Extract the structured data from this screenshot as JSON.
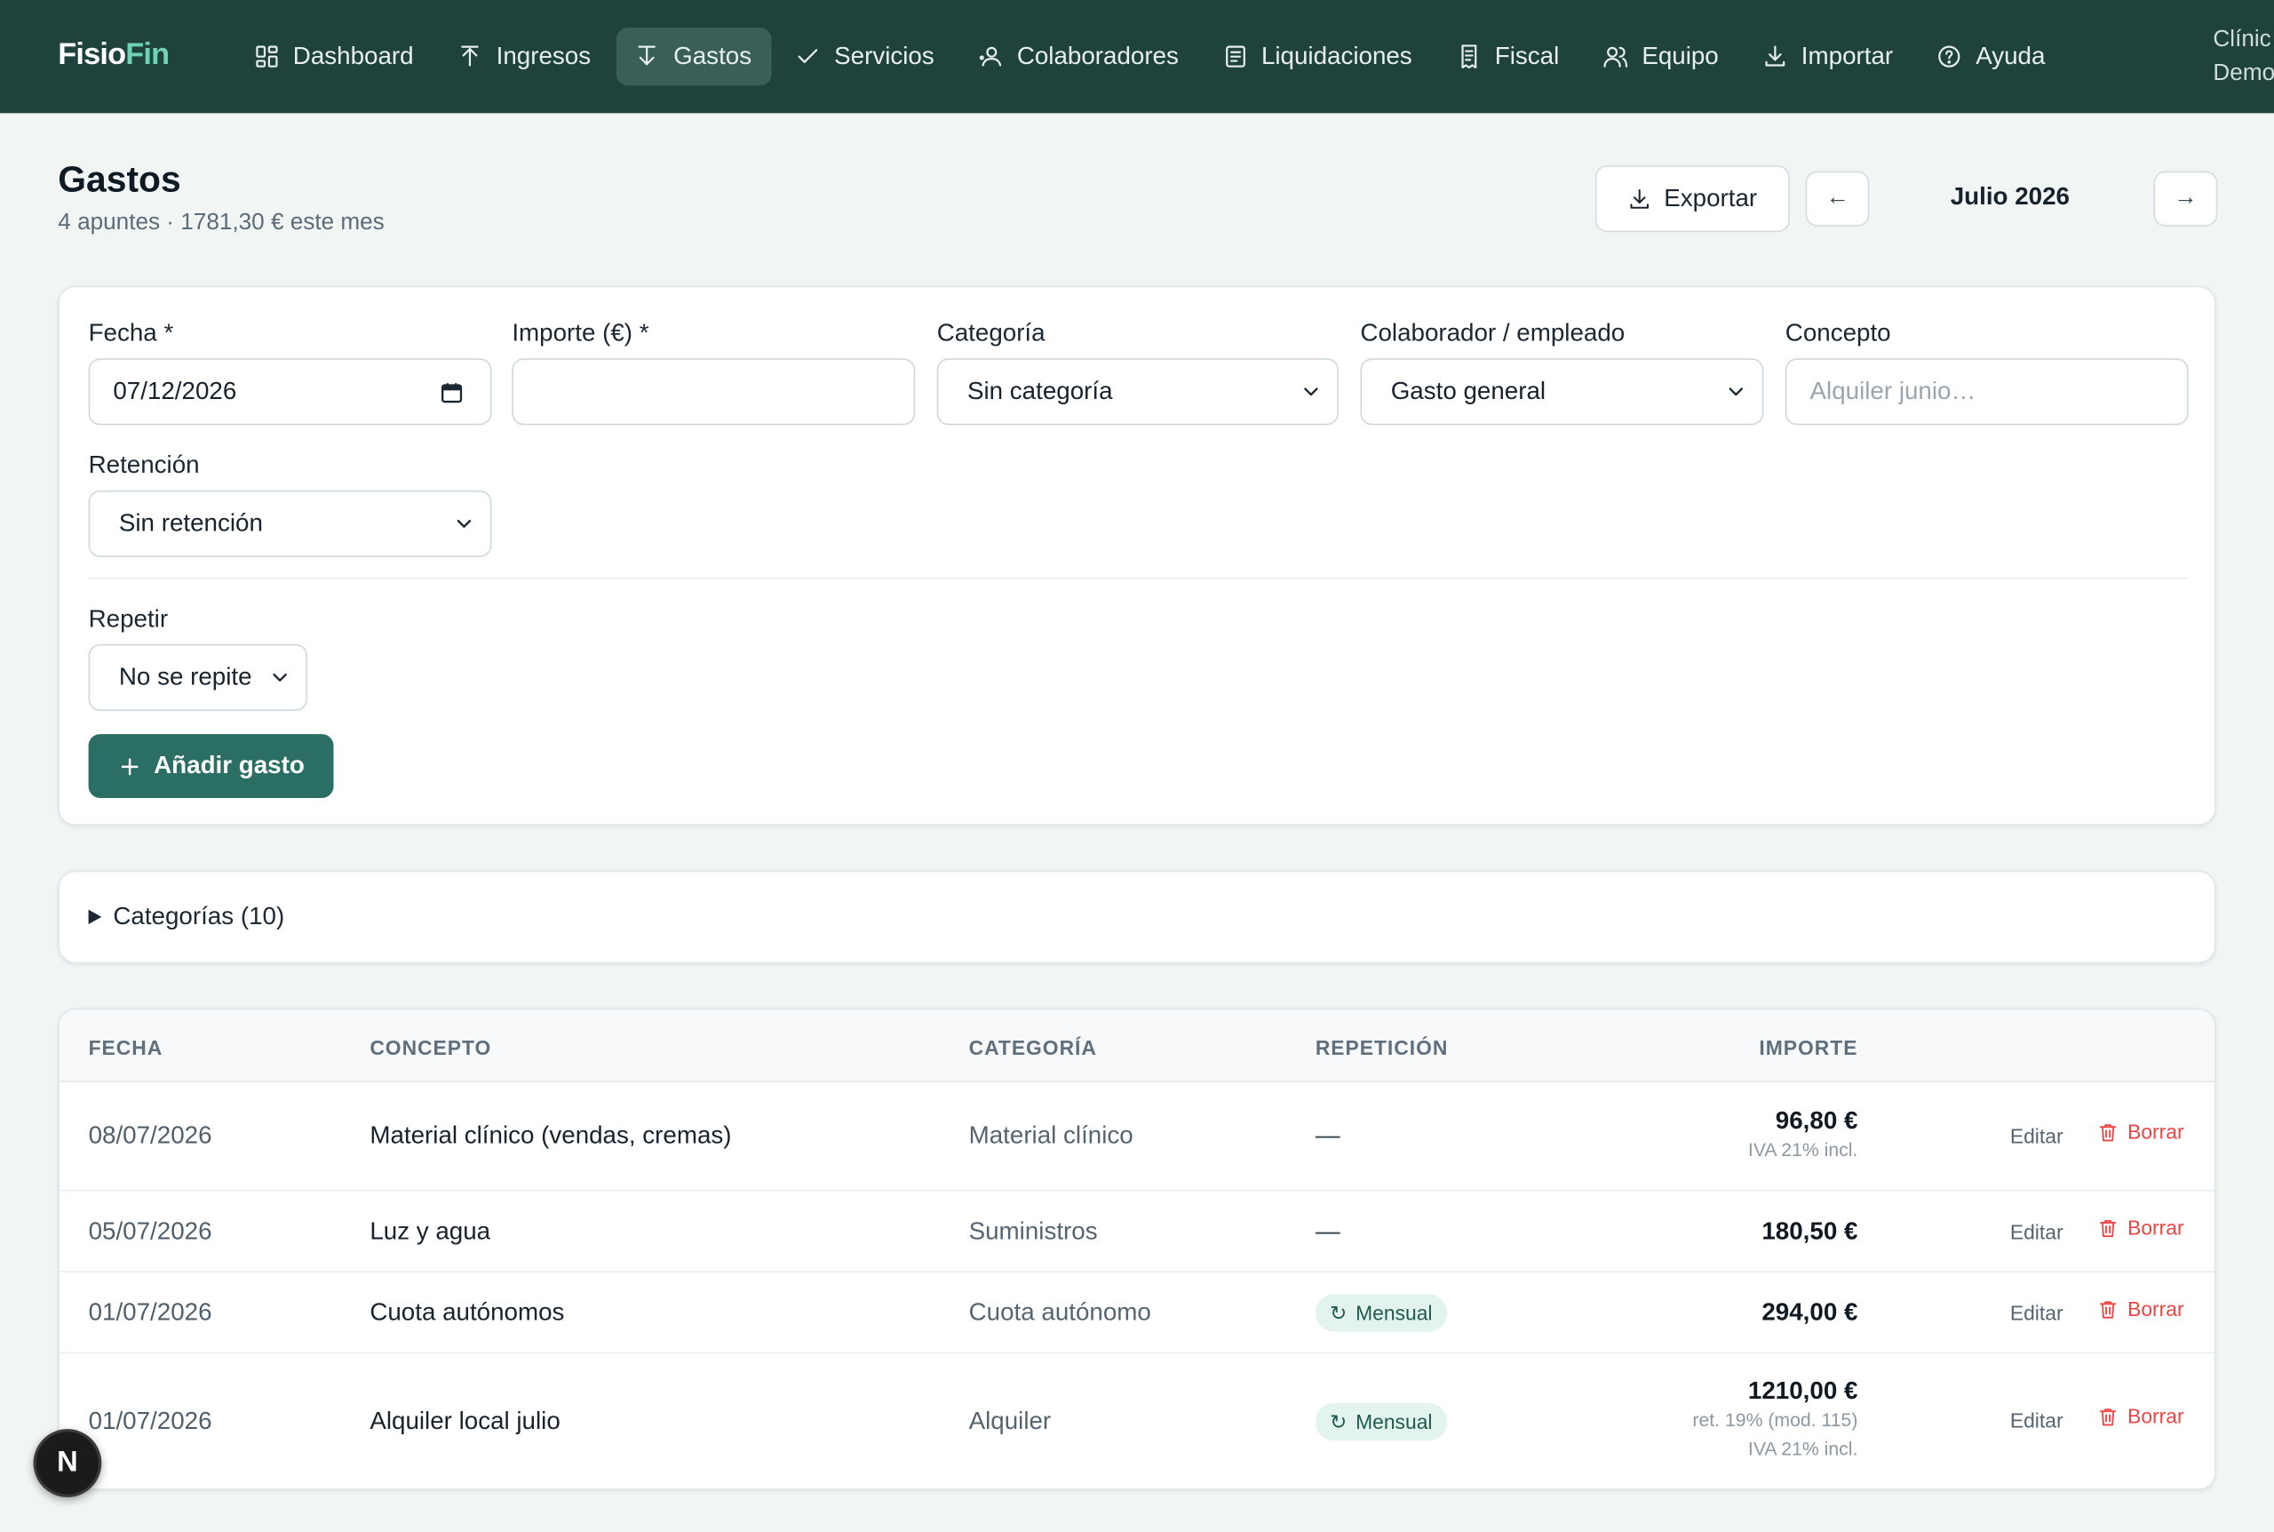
{
  "brand": {
    "part1": "Fisio",
    "part2": "Fin"
  },
  "nav": [
    {
      "label": "Dashboard",
      "icon": "dashboard-icon"
    },
    {
      "label": "Ingresos",
      "icon": "upload-icon"
    },
    {
      "label": "Gastos",
      "icon": "download-bar-icon",
      "active": true
    },
    {
      "label": "Servicios",
      "icon": "check-icon"
    },
    {
      "label": "Colaboradores",
      "icon": "user-icon"
    },
    {
      "label": "Liquidaciones",
      "icon": "document-icon"
    },
    {
      "label": "Fiscal",
      "icon": "receipt-icon"
    },
    {
      "label": "Equipo",
      "icon": "users-icon"
    },
    {
      "label": "Importar",
      "icon": "import-icon"
    },
    {
      "label": "Ayuda",
      "icon": "help-icon"
    }
  ],
  "clinic": {
    "line1": "Clínic",
    "line2": "Demo"
  },
  "header": {
    "title": "Gastos",
    "subtitle": "4 apuntes · 1781,30 € este mes",
    "export_label": "Exportar",
    "prev_label": "←",
    "next_label": "→",
    "month": "Julio 2026"
  },
  "form": {
    "fecha_label": "Fecha *",
    "fecha_value": "07/12/2026",
    "importe_label": "Importe (€) *",
    "importe_value": "",
    "categoria_label": "Categoría",
    "categoria_value": "Sin categoría",
    "colaborador_label": "Colaborador / empleado",
    "colaborador_value": "Gasto general",
    "concepto_label": "Concepto",
    "concepto_placeholder": "Alquiler junio…",
    "retencion_label": "Retención",
    "retencion_value": "Sin retención",
    "repetir_label": "Repetir",
    "repetir_value": "No se repite",
    "add_label": "Añadir gasto"
  },
  "categories_toggle": "Categorías (10)",
  "table": {
    "headers": {
      "fecha": "FECHA",
      "concepto": "CONCEPTO",
      "categoria": "CATEGORÍA",
      "repeticion": "REPETICIÓN",
      "importe": "IMPORTE"
    },
    "edit_label": "Editar",
    "delete_label": "Borrar",
    "rows": [
      {
        "fecha": "08/07/2026",
        "concepto": "Material clínico (vendas, cremas)",
        "categoria": "Material clínico",
        "repeticion": "—",
        "importe": "96,80 €",
        "notes": [
          "IVA 21% incl."
        ]
      },
      {
        "fecha": "05/07/2026",
        "concepto": "Luz y agua",
        "categoria": "Suministros",
        "repeticion": "—",
        "importe": "180,50 €",
        "notes": []
      },
      {
        "fecha": "01/07/2026",
        "concepto": "Cuota autónomos",
        "categoria": "Cuota autónomo",
        "repeticion": "Mensual",
        "importe": "294,00 €",
        "notes": []
      },
      {
        "fecha": "01/07/2026",
        "concepto": "Alquiler local julio",
        "categoria": "Alquiler",
        "repeticion": "Mensual",
        "importe": "1210,00 €",
        "notes": [
          "ret. 19% (mod. 115)",
          "IVA 21% incl."
        ]
      }
    ]
  },
  "dev_badge": "N"
}
